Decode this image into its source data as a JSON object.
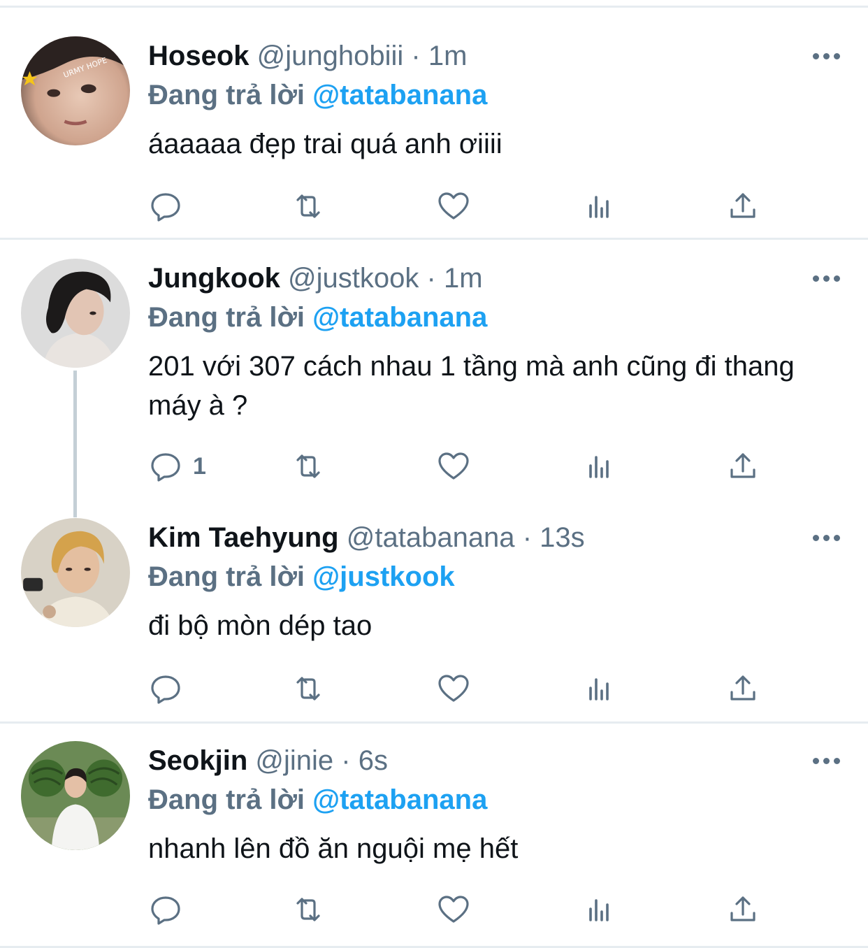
{
  "colors": {
    "accent": "#1da1f2",
    "secondary_text": "#5b7083",
    "divider": "#e6ecf0"
  },
  "tweets": [
    {
      "name": "Hoseok",
      "handle": "@junghobiii",
      "separator": "·",
      "time": "1m",
      "replying_prefix": "Đang trả lời",
      "replying_to": "@tatabanana",
      "text": "áaaaaa đẹp trai quá anh ơiiii",
      "reply_count": "",
      "avatar_text": "URMY HOPE"
    },
    {
      "name": "Jungkook",
      "handle": "@justkook",
      "separator": "·",
      "time": "1m",
      "replying_prefix": "Đang trả lời",
      "replying_to": "@tatabanana",
      "text": "201 với 307 cách nhau 1 tầng mà anh cũng đi thang máy à ?",
      "reply_count": "1"
    },
    {
      "name": "Kim Taehyung",
      "handle": "@tatabanana",
      "separator": "·",
      "time": "13s",
      "replying_prefix": "Đang trả lời",
      "replying_to": "@justkook",
      "text": "đi bộ mòn dép tao",
      "reply_count": ""
    },
    {
      "name": "Seokjin",
      "handle": "@jinie",
      "separator": "·",
      "time": "6s",
      "replying_prefix": "Đang trả lời",
      "replying_to": "@tatabanana",
      "text": "nhanh lên đồ ăn nguội mẹ hết",
      "reply_count": ""
    }
  ],
  "action_icons": [
    "reply-icon",
    "retweet-icon",
    "like-icon",
    "analytics-icon",
    "share-icon"
  ]
}
